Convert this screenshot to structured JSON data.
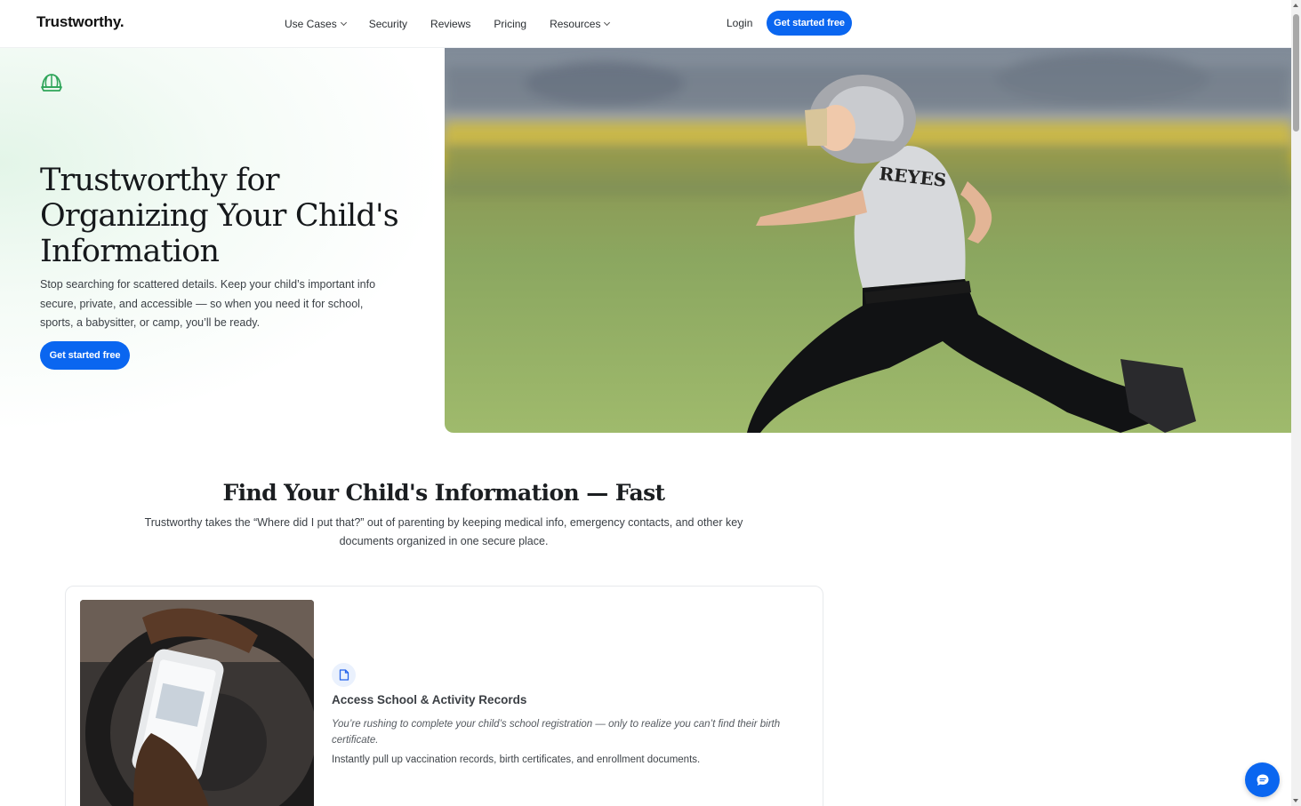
{
  "header": {
    "logo": "Trustworthy.",
    "nav": [
      {
        "label": "Use Cases",
        "dropdown": true
      },
      {
        "label": "Security",
        "dropdown": false
      },
      {
        "label": "Reviews",
        "dropdown": false
      },
      {
        "label": "Pricing",
        "dropdown": false
      },
      {
        "label": "Resources",
        "dropdown": true
      }
    ],
    "login": "Login",
    "cta": "Get started free"
  },
  "hero": {
    "icon": "baseball-cap-icon",
    "title": "Trustworthy for Organizing Your Child's Information",
    "subtitle": "Stop searching for scattered details. Keep your child’s important info secure, private, and accessible — so when you need it for school, sports, a babysitter, or camp, you’ll be ready.",
    "cta": "Get started free",
    "image_jersey_text": "REYES"
  },
  "section": {
    "title": "Find Your Child's Information — Fast",
    "subtitle": "Trustworthy takes the “Where did I put that?” out of parenting by keeping medical info, emergency contacts, and other key documents organized in one secure place."
  },
  "card": {
    "icon": "document-icon",
    "title": "Access School & Activity Records",
    "quote": "You’re rushing to complete your child’s school registration — only to realize you can’t find their birth certificate.",
    "body": "Instantly pull up vaccination records, birth certificates, and enrollment documents."
  },
  "chat": {
    "icon": "chat-icon"
  },
  "colors": {
    "primary": "#0a66f0",
    "accent_green": "#2fa55a"
  }
}
